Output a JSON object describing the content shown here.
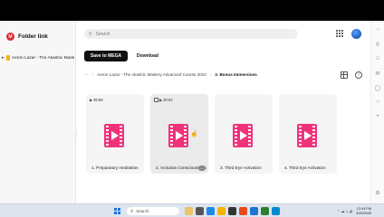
{
  "brand": {
    "title": "Folder link"
  },
  "sidebar": {
    "tree_item": "Aeron Lazar - The Akashic Mastery Advanced Course 2024"
  },
  "search": {
    "placeholder": "Search"
  },
  "toolbar": {
    "save_label": "Save to MEGA",
    "download_label": "Download"
  },
  "breadcrumb": {
    "items": [
      "Aeron Lazar - The Akashic Mastery Advanced Course 2024",
      "2. Bonus Immersions"
    ]
  },
  "files": [
    {
      "duration": "35:58",
      "name": "1. Preparatory meditation"
    },
    {
      "duration": "20:02",
      "name": "2. Arcturian Consciousness"
    },
    {
      "duration": "",
      "name": "3. Third Eye Activation"
    },
    {
      "duration": "",
      "name": "4. Third Eye Activation"
    }
  ],
  "taskbar": {
    "search_label": "Search",
    "time": "12:04 PM",
    "date": "3/25/2025"
  },
  "colors": {
    "accent": "#d9272e",
    "video_thumb": "#f0327a"
  }
}
